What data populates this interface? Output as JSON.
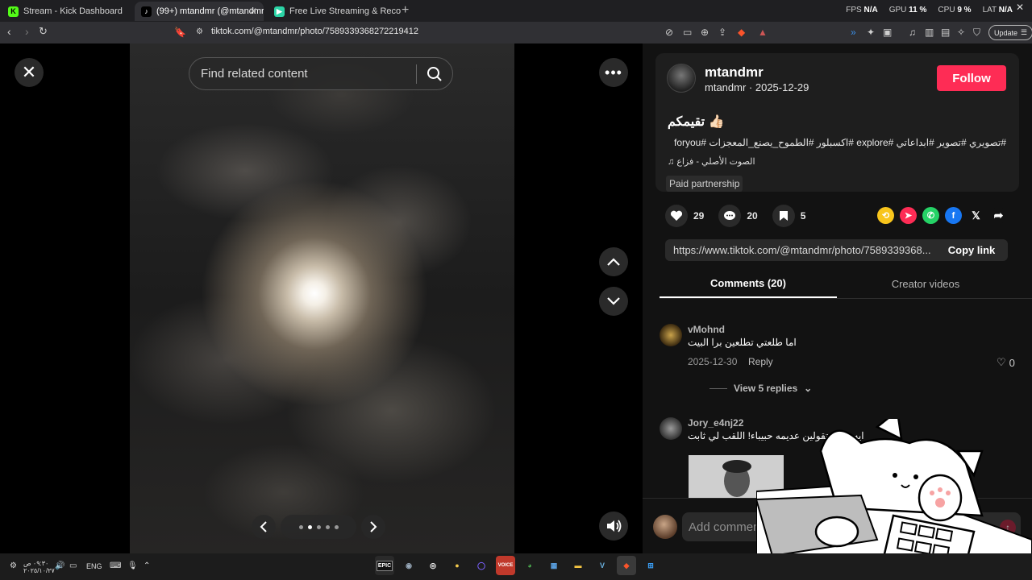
{
  "browser": {
    "tabs": [
      {
        "title": "Stream - Kick Dashboard",
        "favicon": "K",
        "color": "#53fc18"
      },
      {
        "title": "(99+) mtandmr (@mtandmr) |",
        "favicon": "♪",
        "color": "#000000"
      },
      {
        "title": "Free Live Streaming & Recording Sof",
        "favicon": "▶",
        "color": "#2bd4a6"
      }
    ],
    "url": "tiktok.com/@mtandmr/photo/7589339368272219412",
    "stats": {
      "fps_label": "FPS",
      "fps": "N/A",
      "gpu_label": "GPU",
      "gpu": "11 %",
      "cpu_label": "CPU",
      "cpu": "9 %",
      "lat_label": "LAT",
      "lat": "N/A"
    },
    "update_label": "Update"
  },
  "viewer": {
    "search_placeholder": "Find related content",
    "slide_count": 5,
    "active_slide": 2
  },
  "post": {
    "username": "mtandmr",
    "handle": "mtandmr",
    "date": "2025-12-29",
    "follow_label": "Follow",
    "caption": "تقيمكم 👍🏻",
    "hashtags": "#تصويري #تصوير #ابداعاتي #explore #اكسبلور #الطموح_يصنع_المعجزات #foryou",
    "music": "♫  الصوت الأصلي - فزاع",
    "paid_label": "Paid partnership",
    "likes": "29",
    "comments": "20",
    "saves": "5",
    "link": "https://www.tiktok.com/@mtandmr/photo/7589339368...",
    "copy_label": "Copy link",
    "share_colors": {
      "repost": "#f8c51c",
      "send": "#fe2c55",
      "whatsapp": "#25d366",
      "facebook": "#1877f2",
      "x": "#000000"
    }
  },
  "tabs": {
    "comments": "Comments (20)",
    "creator": "Creator videos"
  },
  "comments": [
    {
      "user": "vMohnd",
      "text": "اما طلعتي تطلعين برا البيت",
      "date": "2025-12-30",
      "reply": "Reply",
      "likes": "0",
      "view_replies": "View 5 replies"
    },
    {
      "user": "Jory_e4nj22",
      "text": "ايه بس وتقولين عديمه حبيباء! اللقب لي ثابت"
    }
  ],
  "comment_bar": {
    "placeholder": "Add comment..."
  },
  "taskbar": {
    "time": "٠٩:٣٠ ص",
    "date": "٢٠٢٥/١٠/٢٧",
    "lang": "ENG"
  }
}
